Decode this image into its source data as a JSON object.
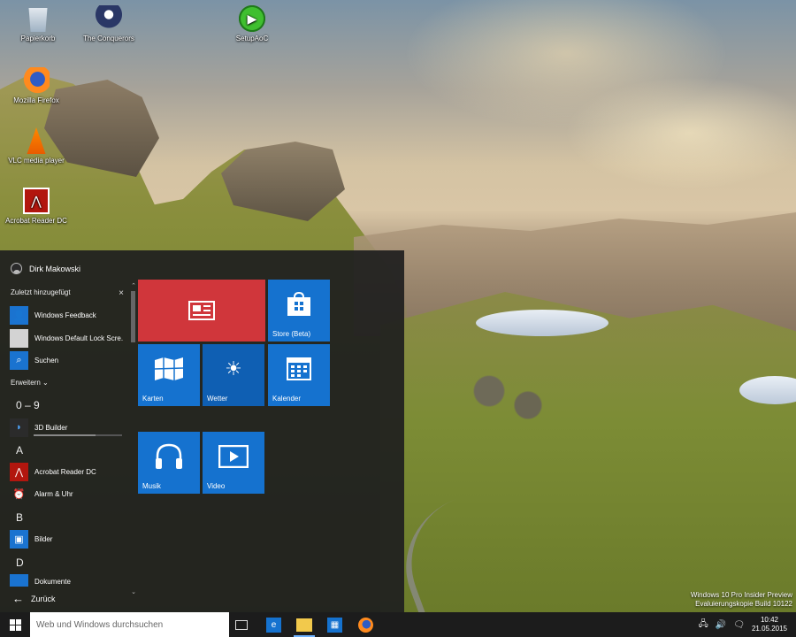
{
  "desktop": {
    "icons": [
      {
        "label": "Papierkorb",
        "icon": "recycle-bin-icon"
      },
      {
        "label": "The Conquerors",
        "icon": "conquerors-icon"
      },
      {
        "label": "SetupAoC",
        "icon": "setup-icon"
      },
      {
        "label": "Mozilla Firefox",
        "icon": "firefox-icon"
      },
      {
        "label": "VLC media player",
        "icon": "vlc-icon"
      },
      {
        "label": "Acrobat Reader DC",
        "icon": "acrobat-icon"
      }
    ],
    "watermark": {
      "line1": "Windows 10 Pro Insider Preview",
      "line2": "Evaluierungskopie Build 10122"
    }
  },
  "start_menu": {
    "user_name": "Dirk Makowski",
    "recent_header": "Zuletzt hinzugefügt",
    "close_symbol": "×",
    "recent_apps": [
      {
        "label": "Windows Feedback",
        "icon": "feedback-icon"
      },
      {
        "label": "Windows Default Lock Scre...",
        "icon": "lock-screen-icon"
      },
      {
        "label": "Suchen",
        "icon": "search-icon"
      }
    ],
    "expand_label": "Erweitern",
    "groups": [
      {
        "letter": "0 – 9",
        "apps": [
          {
            "label": "3D Builder",
            "icon": "3d-builder-icon"
          }
        ]
      },
      {
        "letter": "A",
        "apps": [
          {
            "label": "Acrobat Reader DC",
            "icon": "acrobat-icon"
          },
          {
            "label": "Alarm & Uhr",
            "icon": "alarm-clock-icon"
          }
        ]
      },
      {
        "letter": "B",
        "apps": [
          {
            "label": "Bilder",
            "icon": "photos-icon"
          }
        ]
      },
      {
        "letter": "D",
        "apps": [
          {
            "label": "Dokumente",
            "icon": "documents-icon"
          }
        ]
      }
    ],
    "install_progress": 0.7,
    "back_label": "Zurück",
    "tiles": [
      {
        "label": "",
        "icon": "news-icon",
        "color": "#d0363b"
      },
      {
        "label": "Store (Beta)",
        "icon": "store-icon",
        "color": "#1572cf"
      },
      {
        "label": "Karten",
        "icon": "maps-icon",
        "color": "#1572cf"
      },
      {
        "label": "Wetter",
        "icon": "weather-icon",
        "color": "#1572cf"
      },
      {
        "label": "Kalender",
        "icon": "calendar-icon",
        "color": "#1572cf"
      },
      {
        "label": "Musik",
        "icon": "headphones-icon",
        "color": "#1572cf"
      },
      {
        "label": "Video",
        "icon": "video-icon",
        "color": "#1572cf"
      }
    ]
  },
  "taskbar": {
    "search_placeholder": "Web und Windows durchsuchen",
    "pinned": [
      "task-view-icon",
      "internet-explorer-icon",
      "file-explorer-icon",
      "store-icon",
      "firefox-icon"
    ],
    "tray_icons": [
      "network-icon",
      "volume-icon",
      "notification-icon"
    ],
    "time": "10:42",
    "date": "21.05.2015"
  }
}
